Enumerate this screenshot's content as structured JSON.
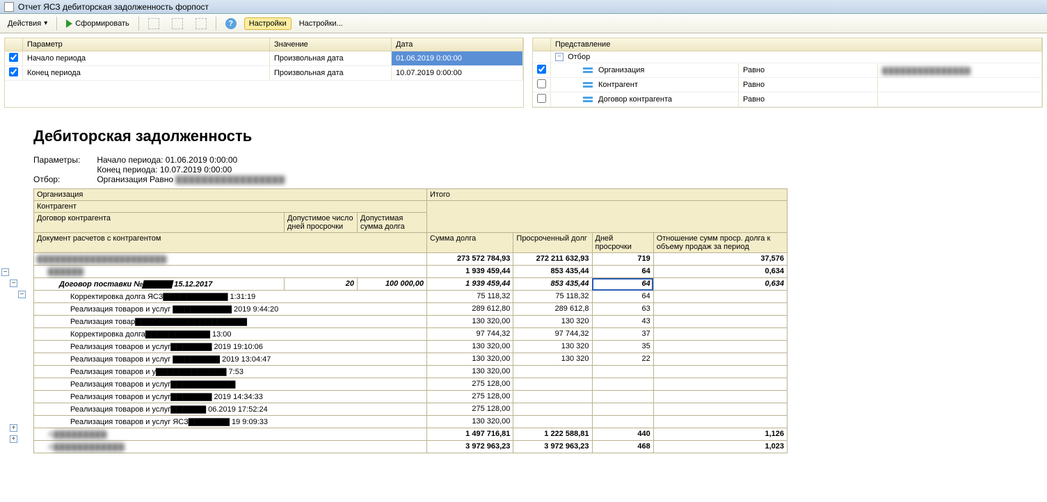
{
  "window": {
    "title": "Отчет  ЯСЗ дебиторская задолженность форпост"
  },
  "toolbar": {
    "actions": "Действия",
    "form": "Сформировать",
    "settings_btn": "Настройки",
    "settings_link": "Настройки..."
  },
  "param_grid": {
    "h_param": "Параметр",
    "h_value": "Значение",
    "h_date": "Дата",
    "rows": [
      {
        "checked": true,
        "param": "Начало периода",
        "value": "Произвольная дата",
        "date": "01.06.2019 0:00:00",
        "selected": true
      },
      {
        "checked": true,
        "param": "Конец периода",
        "value": "Произвольная дата",
        "date": "10.07.2019 0:00:00",
        "selected": false
      }
    ]
  },
  "repr_grid": {
    "h_repr": "Представление",
    "root": "Отбор",
    "cond": "Равно",
    "rows": [
      {
        "checked": true,
        "label": "Организация",
        "value_blurred": true
      },
      {
        "checked": false,
        "label": "Контрагент",
        "value_blurred": false
      },
      {
        "checked": false,
        "label": "Договор контрагента",
        "value_blurred": false
      }
    ]
  },
  "report": {
    "title": "Дебиторская задолженность",
    "params_label": "Параметры:",
    "param_start": "Начало периода: 01.06.2019 0:00:00",
    "param_end": "Конец периода: 10.07.2019 0:00:00",
    "filter_label": "Отбор:",
    "filter_text": "Организация Равно",
    "hdr": {
      "org": "Организация",
      "contr": "Контрагент",
      "contract": "Договор контрагента",
      "allow_days": "Допустимое число дней просрочки",
      "allow_sum": "Допустимая сумма долга",
      "total": "Итого",
      "doc": "Документ расчетов с контрагентом",
      "debt": "Сумма долга",
      "overdue": "Просроченный долг",
      "days": "Дней просрочки",
      "ratio": "Отношение сумм проср. долга к объему продаж за период"
    },
    "rows": [
      {
        "type": "g0",
        "doc": "▇▇▇▇▇▇▇▇▇▇▇▇▇▇▇▇▇▇▇▇▇▇",
        "blur": true,
        "c1": "273 572 784,93",
        "c2": "272 211 632,93",
        "c3": "719",
        "c4": "37,576"
      },
      {
        "type": "g1",
        "doc": "▇▇▇▇▇▇",
        "blur": true,
        "c1": "1 939 459,44",
        "c2": "853 435,44",
        "c3": "64",
        "c4": "0,634"
      },
      {
        "type": "g2",
        "doc": "Договор поставки №▇▇▇▇▇ 15.12.2017",
        "blur": false,
        "days": "20",
        "sum": "100 000,00",
        "c1": "1 939 459,44",
        "c2": "853 435,44",
        "c3": "64",
        "c4": "0,634",
        "sel": true
      },
      {
        "type": "d",
        "doc": "Корректировка долга ЯСЗ▇▇▇▇▇▇▇▇▇▇▇ 1:31:19",
        "c1": "75 118,32",
        "c2": "75 118,32",
        "c3": "64",
        "c4": ""
      },
      {
        "type": "d",
        "doc": "Реализация товаров и услуг ▇▇▇▇▇▇▇▇▇▇ 2019 9:44:20",
        "c1": "289 612,80",
        "c2": "289 612,8",
        "c3": "63",
        "c4": ""
      },
      {
        "type": "d",
        "doc": "Реализация товар▇▇▇▇▇▇▇▇▇▇▇▇▇▇▇▇▇▇▇",
        "c1": "130 320,00",
        "c2": "130 320",
        "c3": "43",
        "c4": ""
      },
      {
        "type": "d",
        "doc": "Корректировка долга▇▇▇▇▇▇▇▇▇▇▇ 13:00",
        "c1": "97 744,32",
        "c2": "97 744,32",
        "c3": "37",
        "c4": ""
      },
      {
        "type": "d",
        "doc": "Реализация товаров и услуг▇▇▇▇▇▇▇ 2019 19:10:06",
        "c1": "130 320,00",
        "c2": "130 320",
        "c3": "35",
        "c4": ""
      },
      {
        "type": "d",
        "doc": "Реализация товаров и услуг ▇▇▇▇▇▇▇▇ 2019 13:04:47",
        "c1": "130 320,00",
        "c2": "130 320",
        "c3": "22",
        "c4": ""
      },
      {
        "type": "d",
        "doc": "Реализация товаров и у▇▇▇▇▇▇▇▇▇▇▇▇ 7:53",
        "c1": "130 320,00",
        "c2": "",
        "c3": "",
        "c4": ""
      },
      {
        "type": "d",
        "doc": "Реализация товаров и услуг▇▇▇▇▇▇▇▇▇▇▇",
        "c1": "275 128,00",
        "c2": "",
        "c3": "",
        "c4": ""
      },
      {
        "type": "d",
        "doc": "Реализация товаров и услуг▇▇▇▇▇▇▇ 2019 14:34:33",
        "c1": "275 128,00",
        "c2": "",
        "c3": "",
        "c4": ""
      },
      {
        "type": "d",
        "doc": "Реализация товаров и услуг▇▇▇▇▇▇ 06.2019 17:52:24",
        "c1": "275 128,00",
        "c2": "",
        "c3": "",
        "c4": ""
      },
      {
        "type": "d",
        "doc": "Реализация товаров и услуг ЯСЗ▇▇▇▇▇▇▇ 19 9:09:33",
        "c1": "130 320,00",
        "c2": "",
        "c3": "",
        "c4": ""
      },
      {
        "type": "g1b",
        "doc": "А▇▇▇▇▇▇▇▇▇",
        "blur": true,
        "c1": "1 497 716,81",
        "c2": "1 222 588,81",
        "c3": "440",
        "c4": "1,126"
      },
      {
        "type": "g1b",
        "doc": "А▇▇▇▇▇▇▇▇▇▇▇▇",
        "blur": true,
        "c1": "3 972 963,23",
        "c2": "3 972 963,23",
        "c3": "468",
        "c4": "1,023"
      }
    ]
  }
}
